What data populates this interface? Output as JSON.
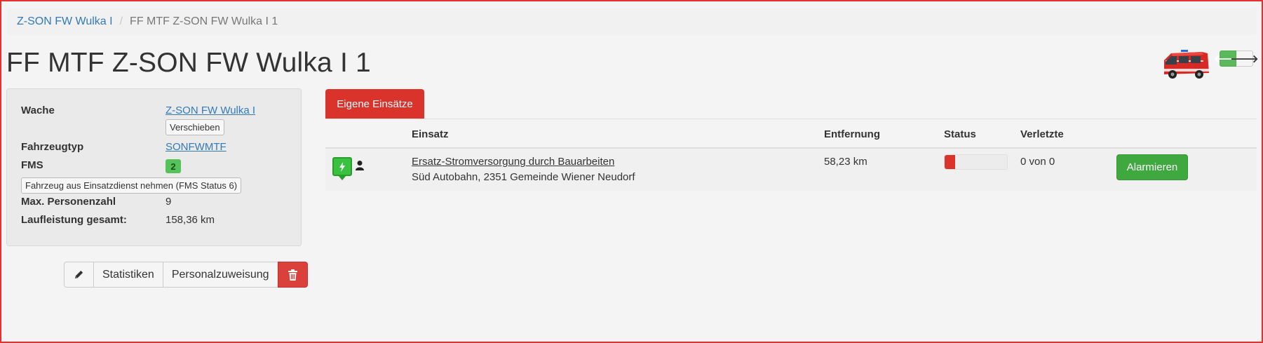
{
  "breadcrumb": {
    "parent": "Z-SON FW Wulka I",
    "separator": "/",
    "current": "FF MTF Z-SON FW Wulka I 1"
  },
  "page_title": "FF MTF Z-SON FW Wulka I 1",
  "vehicle": {
    "image_name": "fire-van-image",
    "prev_icon": "arrow-left-icon",
    "next_icon": "arrow-right-icon",
    "prev_glyph": "🡐",
    "next_glyph": "🡒"
  },
  "info": {
    "wache_label": "Wache",
    "wache_value": "Z-SON FW Wulka I",
    "move_button": "Verschieben",
    "typ_label": "Fahrzeugtyp",
    "typ_value": "SONFWMTF",
    "fms_label": "FMS",
    "fms_value": "2",
    "out_of_service_button": "Fahrzeug aus Einsatzdienst nehmen (FMS Status 6)",
    "persons_label": "Max. Personenzahl",
    "persons_value": "9",
    "mileage_label": "Laufleistung gesamt:",
    "mileage_value": "158,36 km"
  },
  "actions": {
    "edit_icon": "pencil-icon",
    "stats_label": "Statistiken",
    "personnel_label": "Personalzuweisung",
    "delete_icon": "trash-icon"
  },
  "tabs": {
    "active_label": "Eigene Einsätze"
  },
  "table": {
    "headers": {
      "einsatz": "Einsatz",
      "entfernung": "Entfernung",
      "status": "Status",
      "verletzte": "Verletzte"
    },
    "rows": [
      {
        "mission_icon": "lightning-icon",
        "title": "Ersatz-Stromversorgung durch Bauarbeiten",
        "address": "Süd Autobahn, 2351 Gemeinde Wiener Neudorf",
        "distance": "58,23 km",
        "status_progress_percent": 17,
        "injured": "0 von 0",
        "alarm_button": "Alarmieren"
      }
    ]
  },
  "colors": {
    "primary_red": "#d9332c",
    "success_green": "#3fa83f",
    "link_blue": "#337ab7"
  }
}
